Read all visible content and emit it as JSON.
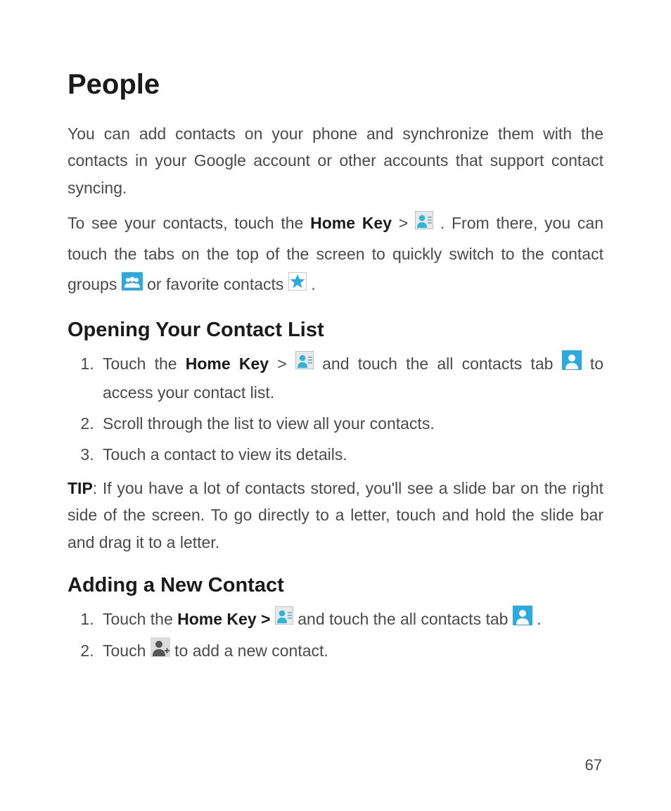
{
  "title": "People",
  "intro_para1": "You can add contacts on your phone and synchronize them with the contacts in your Google account or other accounts that support contact syncing.",
  "intro_para2_a": "To see your contacts, touch the ",
  "intro_para2_bold": "Home Key",
  "intro_para2_b": " > ",
  "intro_para2_c": " . From there, you can touch the tabs on the top of the screen to quickly switch to the contact groups ",
  "intro_para2_d": "  or favorite contacts ",
  "intro_para2_e": " .",
  "section1_title": "Opening Your Contact List",
  "s1_step1_a": "Touch the ",
  "s1_step1_bold": "Home Key",
  "s1_step1_b": " > ",
  "s1_step1_c": " and touch the all contacts tab ",
  "s1_step1_d": "  to access your contact list.",
  "s1_step2": "Scroll through the list to view all your contacts.",
  "s1_step3": "Touch a contact to view its details.",
  "tip_bold": "TIP",
  "tip_text": ": If you have a lot of contacts stored, you'll see a slide bar on the right side of the screen. To go directly to a letter, touch and hold the slide bar and drag it to a letter.",
  "section2_title": "Adding a New Contact",
  "s2_step1_a": "Touch the ",
  "s2_step1_bold": "Home Key >",
  "s2_step1_b": " ",
  "s2_step1_c": "  and touch the all contacts tab ",
  "s2_step1_d": " .",
  "s2_step2_a": "Touch  ",
  "s2_step2_b": "  to add a new contact.",
  "page_number": "67"
}
